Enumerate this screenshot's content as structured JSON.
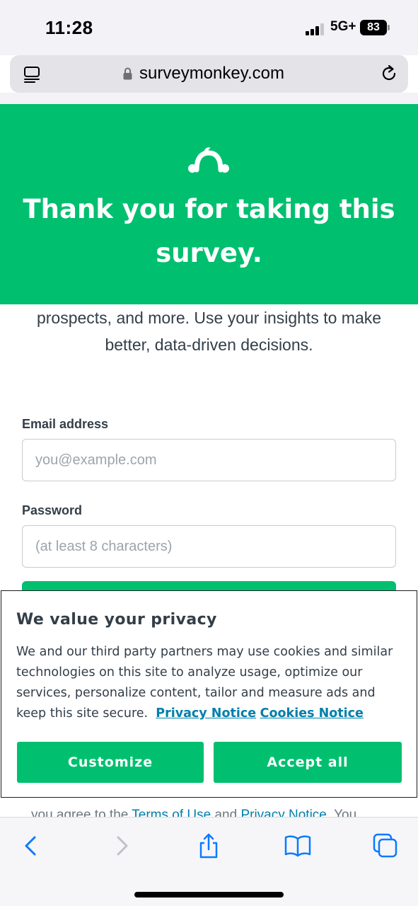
{
  "status_bar": {
    "time": "11:28",
    "network": "5G+",
    "battery": "83"
  },
  "browser": {
    "url": "surveymonkey.com",
    "icons": [
      "reader-icon",
      "lock-icon",
      "reload-icon"
    ]
  },
  "hero": {
    "title": "Thank you for taking this survey.",
    "logo": "surveymonkey-logo-icon",
    "background": "#00bf6f"
  },
  "intro": {
    "text": "prospects, and more. Use your insights to make better, data-driven decisions."
  },
  "form": {
    "email_label": "Email address",
    "email_placeholder": "you@example.com",
    "password_label": "Password",
    "password_placeholder": "(at least 8 characters)"
  },
  "terms": {
    "prefix": "you agree to the ",
    "terms_link": "Terms of Use",
    "and": " and ",
    "privacy_link": "Privacy Notice",
    "suffix": ". You"
  },
  "privacy_banner": {
    "title": "We value your privacy",
    "body": "We and our third party partners may use cookies and similar technologies on this site to analyze usage, optimize our services, personalize content, tailor and measure ads and keep this site secure.",
    "privacy_notice_link": "Privacy Notice",
    "cookies_notice_link": "Cookies Notice",
    "customize_label": "Customize",
    "accept_label": "Accept all"
  },
  "toolbar": {
    "icons": [
      "back-icon",
      "forward-icon",
      "share-icon",
      "bookmarks-icon",
      "tabs-icon"
    ]
  },
  "colors": {
    "brand_green": "#00bf6f",
    "link_blue": "#007faa",
    "ios_blue": "#0a7aff"
  }
}
